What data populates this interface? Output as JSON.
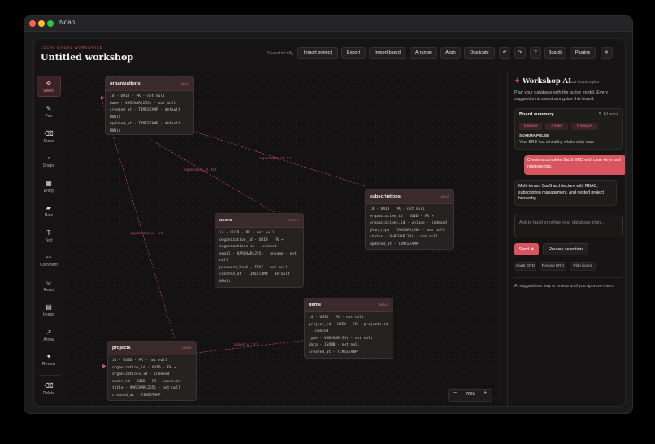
{
  "window": {
    "title": "Noah"
  },
  "header": {
    "eyebrow": "LOCAL VISUAL WORKSPACE",
    "title": "Untitled workshop",
    "saved_status": "Saved locally",
    "buttons": {
      "import_project": "Import project",
      "export": "Export",
      "import_board": "Import board",
      "arrange": "Arrange",
      "align": "Align",
      "duplicate": "Duplicate",
      "undo": "↶",
      "redo": "↷",
      "help": "?",
      "boards": "Boards",
      "plugins": "Plugins",
      "close": "✕"
    }
  },
  "tools": [
    {
      "label": "Select",
      "icon": "✥",
      "active": true
    },
    {
      "label": "Pen",
      "icon": "✎"
    },
    {
      "label": "Erase",
      "icon": "⌫"
    },
    {
      "label": "Shape",
      "icon": "▫"
    },
    {
      "label": "Entity",
      "icon": "▦"
    },
    {
      "label": "Note",
      "icon": "▰"
    },
    {
      "label": "Text",
      "icon": "T"
    },
    {
      "label": "Comment",
      "icon": "☷"
    },
    {
      "label": "React",
      "icon": "☺"
    },
    {
      "label": "Image",
      "icon": "▤"
    },
    {
      "label": "Arrow",
      "icon": "↗"
    },
    {
      "label": "Review",
      "icon": "✦"
    },
    {
      "label": "Delete",
      "icon": "⌫"
    }
  ],
  "tables": {
    "organizations": {
      "name": "organizations",
      "tag": "TABLE",
      "fields": [
        "id · UUID · PK · not null",
        "name · VARCHAR(255) · not null",
        "created_at · TIMESTAMP · default NOW()",
        "updated_at · TIMESTAMP · default NOW()"
      ]
    },
    "users": {
      "name": "users",
      "tag": "TABLE",
      "fields": [
        "id · UUID · PK · not null",
        "organization_id · UUID · FK → organizations.id · indexed",
        "email · VARCHAR(255) · unique · not null",
        "password_hash · TEXT · not null",
        "created_at · TIMESTAMP · default NOW()"
      ]
    },
    "subscriptions": {
      "name": "subscriptions",
      "tag": "TABLE",
      "fields": [
        "id · UUID · PK · not null",
        "organization_id · UUID · FK → organizations.id · unique · indexed",
        "plan_type · VARCHAR(50) · not null",
        "status · VARCHAR(30) · not null",
        "updated_at · TIMESTAMP"
      ]
    },
    "items": {
      "name": "items",
      "tag": "TABLE",
      "fields": [
        "id · UUID · PK · not null",
        "project_id · UUID · FK → projects.id · indexed",
        "type · VARCHAR(50) · not null",
        "data · JSONB · not null",
        "created_at · TIMESTAMP"
      ]
    },
    "projects": {
      "name": "projects",
      "tag": "TABLE",
      "fields": [
        "id · UUID · PK · not null",
        "organization_id · UUID · FK → organizations.id · indexed",
        "owner_id · UUID · FK → users.id",
        "title · VARCHAR(255) · not null",
        "created_at · TIMESTAMP"
      ]
    }
  },
  "relations": {
    "org_subs": "organization_id · 1:1",
    "org_users": "organization_id · N:1",
    "org_projects": "organization_id · N:1",
    "proj_items": "project_id · N:1"
  },
  "zoom": {
    "minus": "−",
    "level": "79%",
    "plus": "+"
  },
  "panel": {
    "title": "Workshop AI",
    "subtitle": "local board copilot",
    "description": "Plan your database with the active model. Every suggestion is saved alongside this board.",
    "summary": {
      "title": "Board summary",
      "count": "5 blocks",
      "chips": [
        "5 tables",
        "4 links",
        "0 images"
      ],
      "pulse_title": "SCHEMA PULSE",
      "pulse_text": "Your ERD has a healthy relationship map."
    },
    "user_message": "Create a complete SaaS ERD with clear keys and relationships.",
    "ai_message": "Multi-tenant SaaS architecture with RBAC, subscription management, and nested project hierarchy.",
    "prompt_placeholder": "Ask to build or refine your database plan...",
    "send_label": "Send ✦",
    "review_label": "Review selection",
    "quick_chips": [
      "SaaS ERD",
      "Review ERD",
      "Plan board"
    ],
    "note": "AI suggestions stay in review until you approve them."
  },
  "colors": {
    "accent": "#d8545f",
    "background": "#161414"
  }
}
